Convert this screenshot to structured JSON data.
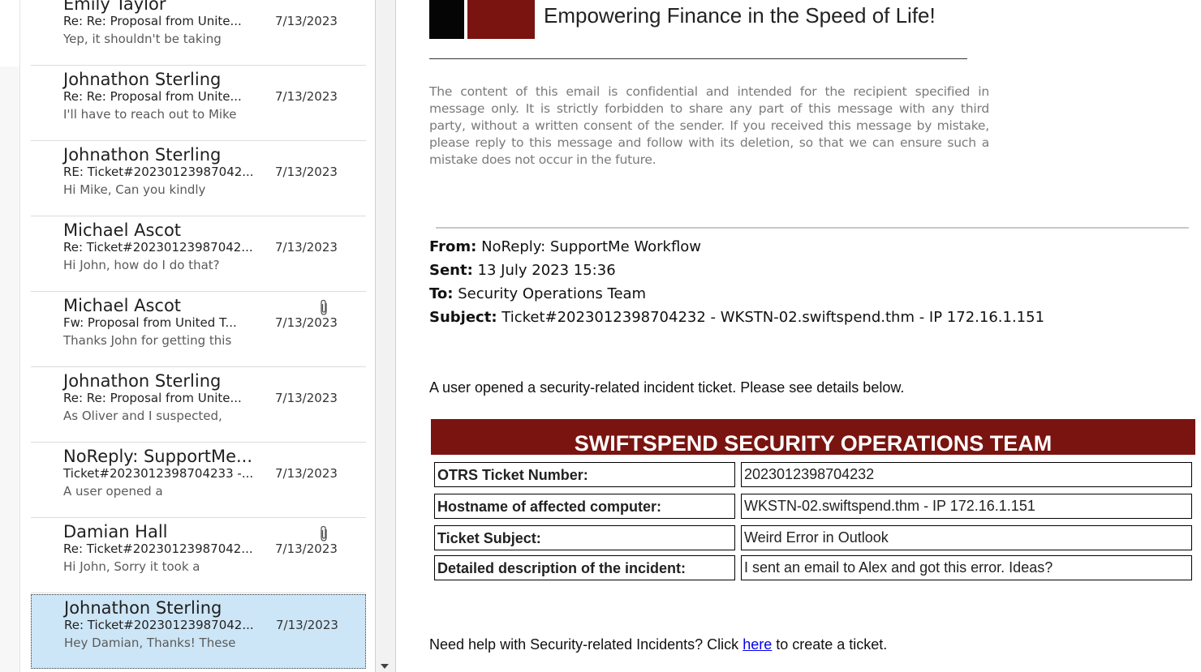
{
  "messages": [
    {
      "sender": "Emily Taylor",
      "subject": "Re: Re: Proposal from Unite...",
      "date": "7/13/2023",
      "preview": "Yep, it shouldn't be taking",
      "attachment": false,
      "selected": false
    },
    {
      "sender": "Johnathon Sterling",
      "subject": "Re: Re: Proposal from Unite...",
      "date": "7/13/2023",
      "preview": "I'll have to reach out to Mike",
      "attachment": false,
      "selected": false
    },
    {
      "sender": "Johnathon Sterling",
      "subject": "RE: Ticket#20230123987042...",
      "date": "7/13/2023",
      "preview": "Hi Mike,  Can you kindly",
      "attachment": false,
      "selected": false
    },
    {
      "sender": "Michael Ascot",
      "subject": "Re: Ticket#20230123987042...",
      "date": "7/13/2023",
      "preview": "Hi John, how do I do that?",
      "attachment": false,
      "selected": false
    },
    {
      "sender": "Michael Ascot",
      "subject": "Fw: Proposal from United T...",
      "date": "7/13/2023",
      "preview": "Thanks John for getting this",
      "attachment": true,
      "selected": false
    },
    {
      "sender": "Johnathon Sterling",
      "subject": "Re: Re: Proposal from Unite...",
      "date": "7/13/2023",
      "preview": "As Oliver and I suspected,",
      "attachment": false,
      "selected": false
    },
    {
      "sender": "NoReply: SupportMe...",
      "subject": "Ticket#2023012398704233 -...",
      "date": "7/13/2023",
      "preview": "A user opened a",
      "attachment": false,
      "selected": false
    },
    {
      "sender": "Damian Hall",
      "subject": "Re: Ticket#20230123987042...",
      "date": "7/13/2023",
      "preview": "Hi John,  Sorry it took a",
      "attachment": true,
      "selected": false
    },
    {
      "sender": "Johnathon Sterling",
      "subject": "Re: Ticket#20230123987042...",
      "date": "7/13/2023",
      "preview": "Hey Damian,  Thanks! These",
      "attachment": false,
      "selected": true
    }
  ],
  "email": {
    "tagline": "Empowering Finance in the Speed of Life!",
    "disclaimer": "The content of this email is confidential and intended for the recipient specified in message only. It is strictly forbidden to share any part of this message with any third party, without a written consent of the sender. If you received this message by mistake, please reply to this message and follow with its deletion, so that we can ensure such a mistake does not occur in the future.",
    "from_label": "From:",
    "from": "NoReply: SupportMe Workflow",
    "sent_label": "Sent:",
    "sent": "13 July 2023 15:36",
    "to_label": "To:",
    "to": "Security Operations Team",
    "subject_label": "Subject:",
    "subject": "Ticket#2023012398704232 - WKSTN-02.swiftspend.thm - IP 172.16.1.151",
    "intro": "A user opened a security-related incident ticket. Please see details below.",
    "table_title": "SWIFTSPEND SECURITY OPERATIONS TEAM",
    "table_rows": [
      {
        "label": "OTRS Ticket Number:",
        "value": "2023012398704232"
      },
      {
        "label": "Hostname of affected computer:",
        "value": "WKSTN-02.swiftspend.thm - IP 172.16.1.151"
      },
      {
        "label": "Ticket Subject:",
        "value": "Weird Error in Outlook"
      },
      {
        "label": "Detailed description of the incident:",
        "value": "I sent an email to Alex and got this error. Ideas?"
      }
    ],
    "help_prefix": "Need help with Security-related Incidents? Click ",
    "help_link": "here",
    "help_suffix": " to create a ticket."
  },
  "colors": {
    "brand_red": "#7a1410",
    "selected_bg": "#cde6f7",
    "link": "#0000ee"
  },
  "icons": {
    "attachment": "paperclip-icon",
    "scroll_down": "chevron-down-icon"
  }
}
